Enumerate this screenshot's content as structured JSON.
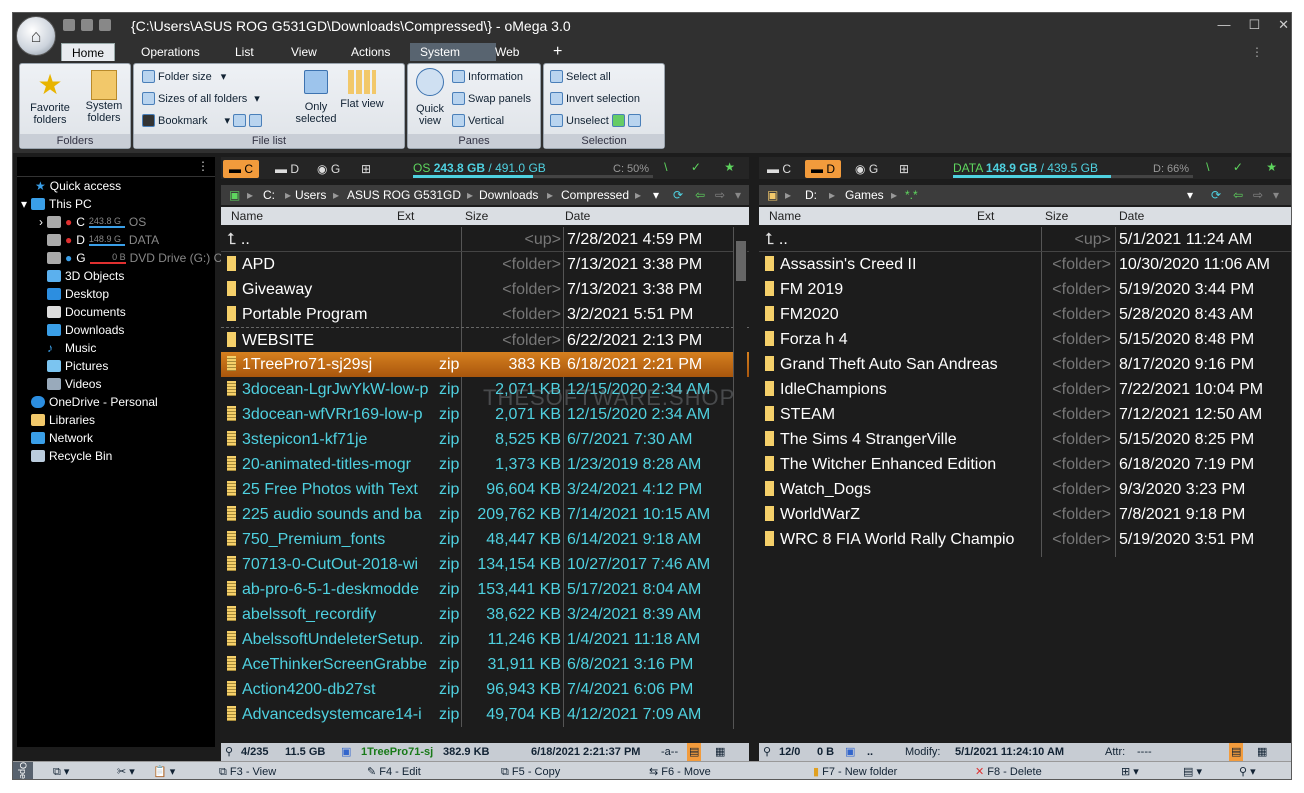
{
  "window": {
    "title": "{C:\\Users\\ASUS ROG G531GD\\Downloads\\Compressed\\} - oMega 3.0"
  },
  "tabs": [
    "Home",
    "Operations",
    "List",
    "View",
    "Actions",
    "System",
    "Web",
    "+"
  ],
  "ribbon": {
    "folders": {
      "caption": "Folders",
      "favorite": "Favorite folders",
      "system": "System folders"
    },
    "filelist": {
      "caption": "File list",
      "folder_size": "Folder size",
      "sizes_all": "Sizes of all folders",
      "bookmark": "Bookmark",
      "only_selected": "Only selected",
      "flat_view": "Flat view"
    },
    "panes": {
      "caption": "Panes",
      "quick_view": "Quick view",
      "information": "Information",
      "swap": "Swap panels",
      "vertical": "Vertical"
    },
    "selection": {
      "caption": "Selection",
      "select_all": "Select all",
      "invert": "Invert selection",
      "unselect": "Unselect"
    }
  },
  "tree": {
    "quick_access": "Quick access",
    "this_pc": "This PC",
    "drives": [
      {
        "letter": "C",
        "size": "243.8 G",
        "label": "OS",
        "fill": 0.5
      },
      {
        "letter": "D",
        "size": "148.9 G",
        "label": "DATA",
        "fill": 0.66
      },
      {
        "letter": "G",
        "size": "0 B",
        "label": "DVD Drive (G:) C",
        "fill": 1
      }
    ],
    "items": [
      "3D Objects",
      "Desktop",
      "Documents",
      "Downloads",
      "Music",
      "Pictures",
      "Videos"
    ],
    "onedrive": "OneDrive - Personal",
    "libraries": "Libraries",
    "network": "Network",
    "recycle": "Recycle Bin"
  },
  "left": {
    "drives": [
      "C",
      "D",
      "G"
    ],
    "free_label": "OS",
    "free": "243.8 GB",
    "total": "/ 491.0 GB",
    "pct": "C: 50%",
    "path": [
      "C:",
      "Users",
      "ASUS ROG G531GD",
      "Downloads",
      "Compressed"
    ],
    "cols": [
      "Name",
      "Ext",
      "Size",
      "Date"
    ],
    "files": [
      {
        "name": "..",
        "ext": "",
        "size": "<up>",
        "date": "7/28/2021 4:59 PM",
        "kind": "up"
      },
      {
        "name": "APD",
        "ext": "",
        "size": "<folder>",
        "date": "7/13/2021 3:38 PM",
        "kind": "folder"
      },
      {
        "name": "Giveaway",
        "ext": "",
        "size": "<folder>",
        "date": "7/13/2021 3:38 PM",
        "kind": "folder"
      },
      {
        "name": "Portable Program",
        "ext": "",
        "size": "<folder>",
        "date": "3/2/2021 5:51 PM",
        "kind": "folder"
      },
      {
        "name": "WEBSITE",
        "ext": "",
        "size": "<folder>",
        "date": "6/22/2021 2:13 PM",
        "kind": "folder"
      },
      {
        "name": "1TreePro71-sj29sj",
        "ext": "zip",
        "size": "383 KB",
        "date": "6/18/2021 2:21 PM",
        "kind": "zip",
        "selected": true
      },
      {
        "name": "3docean-LgrJwYkW-low-p",
        "ext": "zip",
        "size": "2,071 KB",
        "date": "12/15/2020 2:34 AM",
        "kind": "zip"
      },
      {
        "name": "3docean-wfVRr169-low-p",
        "ext": "zip",
        "size": "2,071 KB",
        "date": "12/15/2020 2:34 AM",
        "kind": "zip"
      },
      {
        "name": "3stepicon1-kf71je",
        "ext": "zip",
        "size": "8,525 KB",
        "date": "6/7/2021 7:30 AM",
        "kind": "zip"
      },
      {
        "name": "20-animated-titles-mogr",
        "ext": "zip",
        "size": "1,373 KB",
        "date": "1/23/2019 8:28 AM",
        "kind": "zip"
      },
      {
        "name": "25 Free Photos with Text",
        "ext": "zip",
        "size": "96,604 KB",
        "date": "3/24/2021 4:12 PM",
        "kind": "zip"
      },
      {
        "name": "225 audio sounds and ba",
        "ext": "zip",
        "size": "209,762 KB",
        "date": "7/14/2021 10:15 AM",
        "kind": "zip"
      },
      {
        "name": "750_Premium_fonts",
        "ext": "zip",
        "size": "48,447 KB",
        "date": "6/14/2021 9:18 AM",
        "kind": "zip"
      },
      {
        "name": "70713-0-CutOut-2018-wi",
        "ext": "zip",
        "size": "134,154 KB",
        "date": "10/27/2017 7:46 AM",
        "kind": "zip"
      },
      {
        "name": "ab-pro-6-5-1-deskmodde",
        "ext": "zip",
        "size": "153,441 KB",
        "date": "5/17/2021 8:04 AM",
        "kind": "zip"
      },
      {
        "name": "abelssoft_recordify",
        "ext": "zip",
        "size": "38,622 KB",
        "date": "3/24/2021 8:39 AM",
        "kind": "zip"
      },
      {
        "name": "AbelssoftUndeleterSetup.",
        "ext": "zip",
        "size": "11,246 KB",
        "date": "1/4/2021 11:18 AM",
        "kind": "zip"
      },
      {
        "name": "AceThinkerScreenGrabbe",
        "ext": "zip",
        "size": "31,911 KB",
        "date": "6/8/2021 3:16 PM",
        "kind": "zip"
      },
      {
        "name": "Action4200-db27st",
        "ext": "zip",
        "size": "96,943 KB",
        "date": "7/4/2021 6:06 PM",
        "kind": "zip"
      },
      {
        "name": "Advancedsystemcare14-i",
        "ext": "zip",
        "size": "49,704 KB",
        "date": "4/12/2021 7:09 AM",
        "kind": "zip"
      }
    ],
    "status": {
      "count": "4/235",
      "size": "11.5 GB",
      "file": "1TreePro71-sj:",
      "fsize": "382.9 KB",
      "fdate": "6/18/2021 2:21:37 PM",
      "attr": "-a--"
    }
  },
  "right": {
    "drives": [
      "C",
      "D",
      "G"
    ],
    "free_label": "DATA",
    "free": "148.9 GB",
    "total": "/ 439.5 GB",
    "pct": "D: 66%",
    "path": [
      "D:",
      "Games",
      "*.*"
    ],
    "cols": [
      "Name",
      "Ext",
      "Size",
      "Date"
    ],
    "files": [
      {
        "name": "..",
        "size": "<up>",
        "date": "5/1/2021 11:24 AM",
        "kind": "up"
      },
      {
        "name": "Assassin's Creed II",
        "size": "<folder>",
        "date": "10/30/2020 11:06 AM",
        "kind": "folder"
      },
      {
        "name": "FM 2019",
        "size": "<folder>",
        "date": "5/19/2020 3:44 PM",
        "kind": "folder"
      },
      {
        "name": "FM2020",
        "size": "<folder>",
        "date": "5/28/2020 8:43 AM",
        "kind": "folder"
      },
      {
        "name": "Forza h 4",
        "size": "<folder>",
        "date": "5/15/2020 8:48 PM",
        "kind": "folder"
      },
      {
        "name": "Grand Theft Auto San Andreas",
        "size": "<folder>",
        "date": "8/17/2020 9:16 PM",
        "kind": "folder"
      },
      {
        "name": "IdleChampions",
        "size": "<folder>",
        "date": "7/22/2021 10:04 PM",
        "kind": "folder"
      },
      {
        "name": "STEAM",
        "size": "<folder>",
        "date": "7/12/2021 12:50 AM",
        "kind": "folder"
      },
      {
        "name": "The Sims 4 StrangerVille",
        "size": "<folder>",
        "date": "5/15/2020 8:25 PM",
        "kind": "folder"
      },
      {
        "name": "The Witcher Enhanced Edition",
        "size": "<folder>",
        "date": "6/18/2020 7:19 PM",
        "kind": "folder"
      },
      {
        "name": "Watch_Dogs",
        "size": "<folder>",
        "date": "9/3/2020 3:23 PM",
        "kind": "folder"
      },
      {
        "name": "WorldWarZ",
        "size": "<folder>",
        "date": "7/8/2021 9:18 PM",
        "kind": "folder"
      },
      {
        "name": "WRC 8 FIA World Rally Champio",
        "size": "<folder>",
        "date": "5/19/2020 3:51 PM",
        "kind": "folder"
      }
    ],
    "status": {
      "count": "12/0",
      "size": "0 B",
      "file": "..",
      "modify_label": "Modify:",
      "modify": "5/1/2021 11:24:10 AM",
      "attr_label": "Attr:",
      "attr": "----"
    }
  },
  "fkeys": [
    "F3 - View",
    "F4 - Edit",
    "F5 - Copy",
    "F6 - Move",
    "F7 - New folder",
    "F8 - Delete"
  ],
  "side_label": "Oper",
  "watermark": "THESOFTWARE.SHOP",
  "colors": {
    "cyan": "#4fd1e0",
    "orange": "#e07a1a",
    "green": "#5ed65e",
    "folder": "#f5d06a"
  }
}
